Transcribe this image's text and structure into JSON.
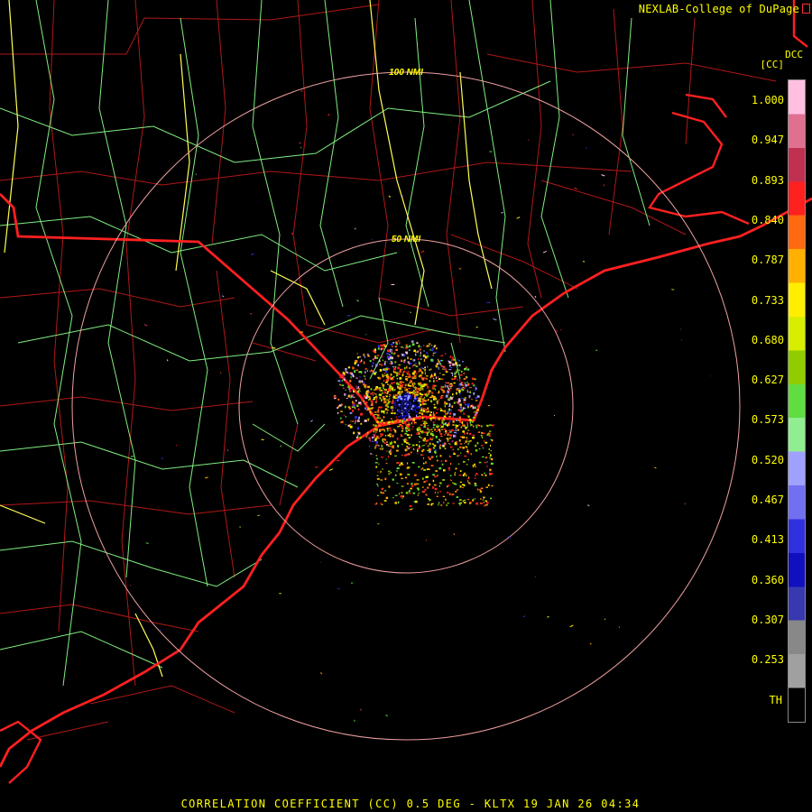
{
  "credit": "NEXLAB-College of DuPage",
  "dcc_label": "DCC",
  "product_tag": "[CC]",
  "title": "CORRELATION COEFFICIENT (CC) 0.5 DEG - KLTX 19 JAN 26 04:34",
  "range_rings": [
    {
      "label": "100 NMI"
    },
    {
      "label": "50 NMI"
    }
  ],
  "colorbar": {
    "ticks": [
      "1.000",
      "0.947",
      "0.893",
      "0.840",
      "0.787",
      "0.733",
      "0.680",
      "0.627",
      "0.573",
      "0.520",
      "0.467",
      "0.413",
      "0.360",
      "0.307",
      "0.253",
      "TH"
    ],
    "colors": [
      "#ffc0e0",
      "#e07090",
      "#c03050",
      "#ff2020",
      "#ff6a10",
      "#ffb000",
      "#ffee00",
      "#d8ee00",
      "#90cc00",
      "#60dd40",
      "#90ee90",
      "#a0a0ff",
      "#7070f0",
      "#3030e0",
      "#1010c0",
      "#3838b0",
      "#888888",
      "#a0a0a0",
      "#000000"
    ]
  },
  "colors": {
    "state_border": "#ff2020",
    "county_border": "#b01818",
    "highway_primary": "#ffff55",
    "highway_secondary": "#80ee80",
    "range_ring": "#f0a0a0",
    "label_text": "#ffff00"
  }
}
